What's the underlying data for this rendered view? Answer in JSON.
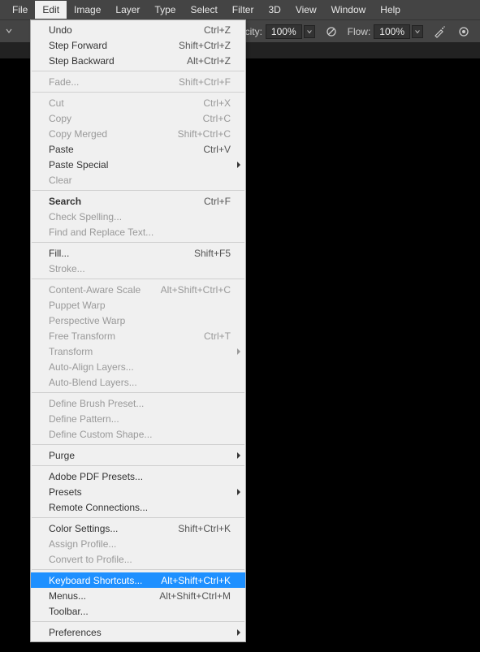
{
  "menubar": [
    "File",
    "Edit",
    "Image",
    "Layer",
    "Type",
    "Select",
    "Filter",
    "3D",
    "View",
    "Window",
    "Help"
  ],
  "menubar_active_index": 1,
  "toolbar": {
    "opacity_label": "Opacity:",
    "opacity_value": "100%",
    "flow_label": "Flow:",
    "flow_value": "100%"
  },
  "menu": [
    {
      "type": "item",
      "label": "Undo",
      "shortcut": "Ctrl+Z"
    },
    {
      "type": "item",
      "label": "Step Forward",
      "shortcut": "Shift+Ctrl+Z"
    },
    {
      "type": "item",
      "label": "Step Backward",
      "shortcut": "Alt+Ctrl+Z"
    },
    {
      "type": "divider"
    },
    {
      "type": "item",
      "label": "Fade...",
      "shortcut": "Shift+Ctrl+F",
      "disabled": true
    },
    {
      "type": "divider"
    },
    {
      "type": "item",
      "label": "Cut",
      "shortcut": "Ctrl+X",
      "disabled": true
    },
    {
      "type": "item",
      "label": "Copy",
      "shortcut": "Ctrl+C",
      "disabled": true
    },
    {
      "type": "item",
      "label": "Copy Merged",
      "shortcut": "Shift+Ctrl+C",
      "disabled": true
    },
    {
      "type": "item",
      "label": "Paste",
      "shortcut": "Ctrl+V"
    },
    {
      "type": "item",
      "label": "Paste Special",
      "submenu": true
    },
    {
      "type": "item",
      "label": "Clear",
      "disabled": true
    },
    {
      "type": "divider"
    },
    {
      "type": "item",
      "label": "Search",
      "shortcut": "Ctrl+F",
      "bold": true
    },
    {
      "type": "item",
      "label": "Check Spelling...",
      "disabled": true
    },
    {
      "type": "item",
      "label": "Find and Replace Text...",
      "disabled": true
    },
    {
      "type": "divider"
    },
    {
      "type": "item",
      "label": "Fill...",
      "shortcut": "Shift+F5"
    },
    {
      "type": "item",
      "label": "Stroke...",
      "disabled": true
    },
    {
      "type": "divider"
    },
    {
      "type": "item",
      "label": "Content-Aware Scale",
      "shortcut": "Alt+Shift+Ctrl+C",
      "disabled": true
    },
    {
      "type": "item",
      "label": "Puppet Warp",
      "disabled": true
    },
    {
      "type": "item",
      "label": "Perspective Warp",
      "disabled": true
    },
    {
      "type": "item",
      "label": "Free Transform",
      "shortcut": "Ctrl+T",
      "disabled": true
    },
    {
      "type": "item",
      "label": "Transform",
      "submenu": true,
      "disabled": true
    },
    {
      "type": "item",
      "label": "Auto-Align Layers...",
      "disabled": true
    },
    {
      "type": "item",
      "label": "Auto-Blend Layers...",
      "disabled": true
    },
    {
      "type": "divider"
    },
    {
      "type": "item",
      "label": "Define Brush Preset...",
      "disabled": true
    },
    {
      "type": "item",
      "label": "Define Pattern...",
      "disabled": true
    },
    {
      "type": "item",
      "label": "Define Custom Shape...",
      "disabled": true
    },
    {
      "type": "divider"
    },
    {
      "type": "item",
      "label": "Purge",
      "submenu": true
    },
    {
      "type": "divider"
    },
    {
      "type": "item",
      "label": "Adobe PDF Presets..."
    },
    {
      "type": "item",
      "label": "Presets",
      "submenu": true
    },
    {
      "type": "item",
      "label": "Remote Connections..."
    },
    {
      "type": "divider"
    },
    {
      "type": "item",
      "label": "Color Settings...",
      "shortcut": "Shift+Ctrl+K"
    },
    {
      "type": "item",
      "label": "Assign Profile...",
      "disabled": true
    },
    {
      "type": "item",
      "label": "Convert to Profile...",
      "disabled": true
    },
    {
      "type": "divider"
    },
    {
      "type": "item",
      "label": "Keyboard Shortcuts...",
      "shortcut": "Alt+Shift+Ctrl+K",
      "highlight": true
    },
    {
      "type": "item",
      "label": "Menus...",
      "shortcut": "Alt+Shift+Ctrl+M"
    },
    {
      "type": "item",
      "label": "Toolbar..."
    },
    {
      "type": "divider"
    },
    {
      "type": "item",
      "label": "Preferences",
      "submenu": true
    }
  ]
}
